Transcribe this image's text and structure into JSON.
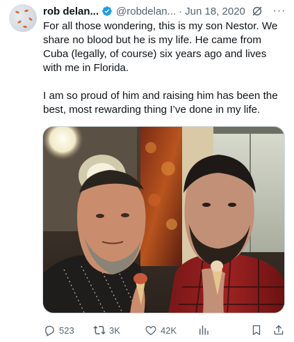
{
  "tweet": {
    "author_name": "rob delan...",
    "handle": "@robdelan...",
    "separator": "·",
    "date": "Jun 18, 2020",
    "text_paragraphs": [
      "For all those wondering, this is my son Nestor.  We share no blood but he is my life. He came from Cuba (legally, of course) six years ago and lives with me in Florida.",
      "I am so proud of him and raising him has been the best, most rewarding thing I’ve done in my life."
    ],
    "more_label": "···",
    "actions": {
      "replies": "523",
      "reposts": "3K",
      "likes": "42K"
    }
  },
  "icons": {
    "verified": "verified-badge-icon",
    "grok": "grok-icon",
    "more": "more-icon",
    "reply": "reply-icon",
    "repost": "repost-icon",
    "like": "like-icon",
    "views": "views-icon",
    "bookmark": "bookmark-icon",
    "share": "share-icon"
  },
  "colors": {
    "text": "#0f1419",
    "secondary": "#536471",
    "verified": "#1d9bf0",
    "border": "#cfd9de"
  }
}
